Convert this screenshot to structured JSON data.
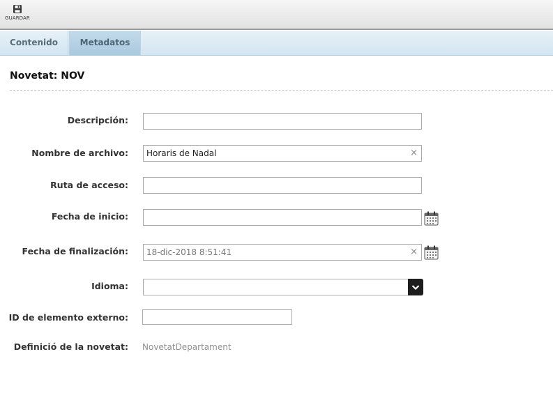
{
  "toolbar": {
    "save_label": "GUARDAR",
    "save_icon": "floppy-disk-icon"
  },
  "tabs": [
    {
      "label": "Contenido"
    },
    {
      "label": "Metadatos"
    }
  ],
  "active_tab": "Metadatos",
  "page_title": "Novetat: NOV",
  "form": {
    "descripcion": {
      "label": "Descripción:",
      "value": ""
    },
    "nombre_archivo": {
      "label": "Nombre de archivo:",
      "value": "Horaris de Nadal"
    },
    "ruta_acceso": {
      "label": "Ruta de acceso:",
      "value": ""
    },
    "fecha_inicio": {
      "label": "Fecha de inicio:",
      "value": ""
    },
    "fecha_finalizacion": {
      "label": "Fecha de finalización:",
      "value": "18-dic-2018 8:51:41"
    },
    "idioma": {
      "label": "Idioma:",
      "value": ""
    },
    "id_externo": {
      "label": "ID de elemento externo:",
      "value": ""
    },
    "definicio": {
      "label": "Definició de la novetat:",
      "value": "NovetatDepartament"
    }
  },
  "icons": {
    "clear": "×",
    "calendar": "calendar-icon",
    "dropdown": "chevron-down-icon"
  }
}
